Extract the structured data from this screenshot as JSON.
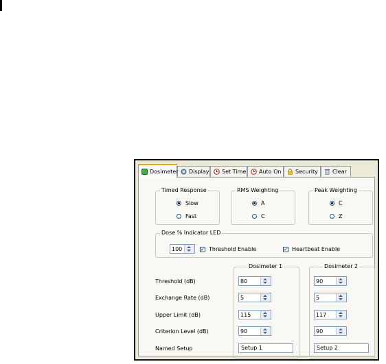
{
  "tabs": [
    {
      "label": "Dosimeter",
      "icon": "dosimeter-icon",
      "active": true
    },
    {
      "label": "Display",
      "icon": "display-gear-icon"
    },
    {
      "label": "Set Time",
      "icon": "clock-icon"
    },
    {
      "label": "Auto On",
      "icon": "alarm-clock-icon"
    },
    {
      "label": "Security",
      "icon": "lock-icon"
    },
    {
      "label": "Clear",
      "icon": "trash-icon"
    }
  ],
  "timed_response": {
    "title": "Timed Response",
    "options": [
      "Slow",
      "Fast"
    ],
    "selected": "Slow"
  },
  "rms_weighting": {
    "title": "RMS Weighting",
    "options": [
      "A",
      "C"
    ],
    "selected": "A"
  },
  "peak_weighting": {
    "title": "Peak Weighting",
    "options": [
      "C",
      "Z"
    ],
    "selected": "C"
  },
  "dose_led": {
    "title": "Dose % Indicator LED",
    "value": "100",
    "threshold_label": "Threshold Enable",
    "threshold_checked": true,
    "heartbeat_label": "Heartbeat Enable",
    "heartbeat_checked": true
  },
  "dosimeter_table": {
    "columns": [
      "Dosimeter 1",
      "Dosimeter 2"
    ],
    "rows": [
      {
        "label": "Threshold (dB)",
        "d1": "80",
        "d2": "90"
      },
      {
        "label": "Exchange Rate (dB)",
        "d1": "5",
        "d2": "5"
      },
      {
        "label": "Upper Limit (dB)",
        "d1": "115",
        "d2": "117"
      },
      {
        "label": "Criterion Level (dB)",
        "d1": "90",
        "d2": "90"
      }
    ],
    "named_setup": {
      "label": "Named Setup",
      "d1": "Setup 1",
      "d2": "Setup 2"
    }
  },
  "colors": {
    "tab_highlight": "#e6a226",
    "panel_bg": "#ece9d8",
    "input_border": "#7f9db9"
  }
}
